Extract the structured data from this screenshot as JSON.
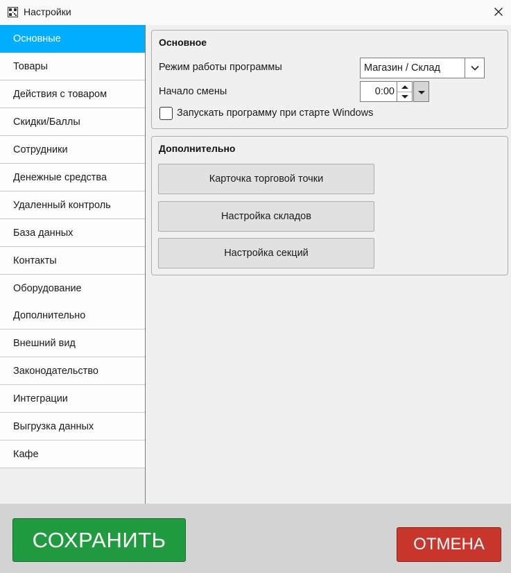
{
  "window": {
    "title": "Настройки",
    "app_icon": "qr-code-icon",
    "close_icon": "close-icon"
  },
  "sidebar": {
    "active_index": 0,
    "active_color": "#00aeff",
    "items": [
      {
        "label": "Основные"
      },
      {
        "label": "Товары"
      },
      {
        "label": "Действия с товаром"
      },
      {
        "label": "Скидки/Баллы"
      },
      {
        "label": "Сотрудники"
      },
      {
        "label": "Денежные средства"
      },
      {
        "label": "Удаленный контроль"
      },
      {
        "label": "База данных"
      },
      {
        "label": "Контакты"
      },
      {
        "label": "Оборудование"
      },
      {
        "label": "Дополнительно"
      },
      {
        "label": "Внешний вид"
      },
      {
        "label": "Законодательство"
      },
      {
        "label": "Интеграции"
      },
      {
        "label": "Выгрузка данных"
      },
      {
        "label": "Кафе"
      }
    ]
  },
  "main": {
    "basic": {
      "title": "Основное",
      "mode_label": "Режим работы программы",
      "mode_value": "Магазин / Склад",
      "shift_label": "Начало смены",
      "shift_value": "0:00",
      "autostart_label": "Запускать программу при старте Windows",
      "autostart_checked": false
    },
    "extra": {
      "title": "Дополнительно",
      "buttons": [
        {
          "label": "Карточка торговой точки"
        },
        {
          "label": "Настройка складов"
        },
        {
          "label": "Настройка секций"
        }
      ]
    }
  },
  "footer": {
    "save_label": "СОХРАНИТЬ",
    "save_color": "#219b3f",
    "cancel_label": "ОТМЕНА",
    "cancel_color": "#c9372c"
  }
}
